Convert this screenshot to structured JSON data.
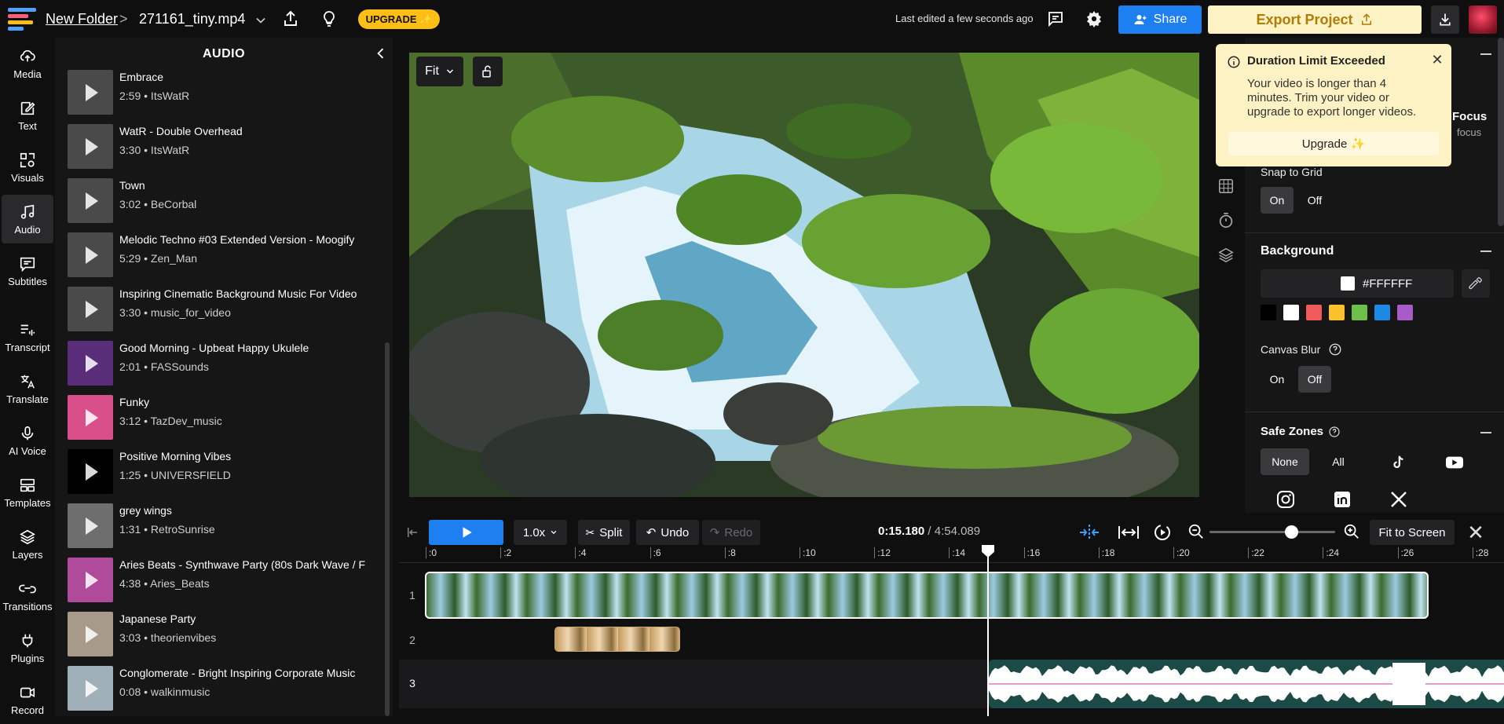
{
  "header": {
    "folder": "New Folder",
    "separator": ">",
    "file_name": "271161_tiny.mp4",
    "upgrade_label": "UPGRADE ✨",
    "last_edited": "Last edited a few seconds ago",
    "share_label": "Share",
    "export_label": "Export Project"
  },
  "sidenav": [
    {
      "label": "Media",
      "icon": "upload-cloud-icon"
    },
    {
      "label": "Text",
      "icon": "text-edit-icon"
    },
    {
      "label": "Visuals",
      "icon": "shapes-icon"
    },
    {
      "label": "Audio",
      "icon": "music-note-icon"
    },
    {
      "label": "Subtitles",
      "icon": "subtitles-icon"
    },
    {
      "label": "Transcript",
      "icon": "transcript-icon"
    },
    {
      "label": "Translate",
      "icon": "translate-icon"
    },
    {
      "label": "AI Voice",
      "icon": "microphone-icon"
    },
    {
      "label": "Templates",
      "icon": "templates-icon"
    },
    {
      "label": "Layers",
      "icon": "layers-icon"
    },
    {
      "label": "Transitions",
      "icon": "transitions-icon"
    },
    {
      "label": "Plugins",
      "icon": "plug-icon"
    },
    {
      "label": "Record",
      "icon": "record-icon"
    }
  ],
  "audio_panel": {
    "title": "AUDIO",
    "tracks": [
      {
        "title": "Embrace",
        "meta": "2:59 • ItsWatR",
        "thumb": "#4a4a4a"
      },
      {
        "title": "WatR - Double Overhead",
        "meta": "3:30 • ItsWatR",
        "thumb": "#4a4a4a"
      },
      {
        "title": "Town",
        "meta": "3:02 • BeCorbal",
        "thumb": "#4a4a4a"
      },
      {
        "title": "Melodic Techno #03 Extended Version - Moogify",
        "meta": "5:29 • Zen_Man",
        "thumb": "#4a4a4a"
      },
      {
        "title": "Inspiring Cinematic Background Music For Video",
        "meta": "3:30 • music_for_video",
        "thumb": "#4a4a4a"
      },
      {
        "title": "Good Morning - Upbeat Happy Ukulele",
        "meta": "2:01 • FASSounds",
        "thumb": "#5a2d7a"
      },
      {
        "title": "Funky",
        "meta": "3:12 • TazDev_music",
        "thumb": "#d94f8a"
      },
      {
        "title": "Positive Morning Vibes",
        "meta": "1:25 • UNIVERSFIELD",
        "thumb": "#000000"
      },
      {
        "title": "grey wings",
        "meta": "1:31 • RetroSunrise",
        "thumb": "#6e6e6e"
      },
      {
        "title": "Aries Beats - Synthwave Party (80s Dark Wave / F",
        "meta": "4:38 • Aries_Beats",
        "thumb": "#b04a9a"
      },
      {
        "title": "Japanese Party",
        "meta": "3:03 • theorienvibes",
        "thumb": "#a89a88"
      },
      {
        "title": "Conglomerate - Bright Inspiring Corporate Music",
        "meta": "0:08 • walkinmusic",
        "thumb": "#9fb0b8"
      }
    ]
  },
  "canvas": {
    "fit_label": "Fit"
  },
  "toast": {
    "title": "Duration Limit Exceeded",
    "body": "Your video is longer than 4 minutes. Trim your video or upgrade to export longer videos.",
    "button": "Upgrade ✨"
  },
  "right_panel": {
    "focus_label": "Focus",
    "focus_sub": "focus",
    "snap_label": "Snap to Grid",
    "snap_on": "On",
    "snap_off": "Off",
    "background_label": "Background",
    "background_hex": "#FFFFFF",
    "swatches": [
      "#000000",
      "#ffffff",
      "#f05a5a",
      "#fbc02d",
      "#6cc04a",
      "#1e88e5",
      "#a85cc8"
    ],
    "canvas_blur_label": "Canvas Blur",
    "blur_on": "On",
    "blur_off": "Off",
    "safe_zones_label": "Safe Zones",
    "safe_none": "None",
    "safe_all": "All"
  },
  "timeline": {
    "speed": "1.0x",
    "split_label": "Split",
    "undo_label": "Undo",
    "redo_label": "Redo",
    "current_time": "0:15.180",
    "total_time": "/ 4:54.089",
    "fit_screen": "Fit to Screen",
    "ticks": [
      ":0",
      ":2",
      ":4",
      ":6",
      ":8",
      ":10",
      ":12",
      ":14",
      ":16",
      ":18",
      ":20",
      ":22",
      ":24",
      ":26",
      ":28"
    ],
    "rows": [
      "1",
      "2",
      "3"
    ]
  }
}
